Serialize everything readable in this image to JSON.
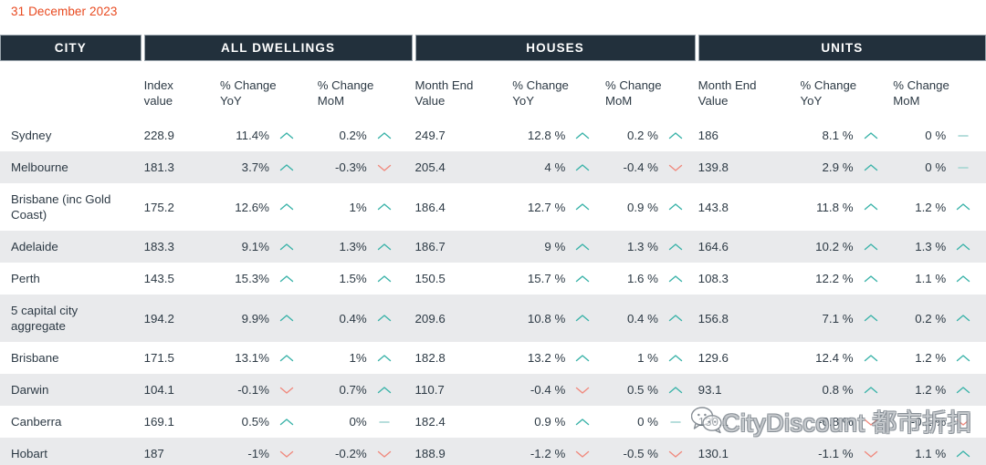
{
  "caption": {
    "date": "31 December 2023",
    "color": "#e8491f"
  },
  "theme": {
    "header_band": "#22303c",
    "alt_row": "#e9eaec",
    "text": "#2d3a45",
    "up": "#3bb3a9",
    "down": "#f08a7e",
    "flat": "#9fd4d0"
  },
  "groups": [
    {
      "label": "CITY"
    },
    {
      "label": "ALL DWELLINGS"
    },
    {
      "label": "HOUSES"
    },
    {
      "label": "UNITS"
    }
  ],
  "columns": [
    {
      "label": ""
    },
    {
      "label": "Index\nvalue"
    },
    {
      "label": "% Change\nYoY"
    },
    {
      "label": "% Change\nMoM"
    },
    {
      "label": "Month End\nValue"
    },
    {
      "label": "% Change\nYoY"
    },
    {
      "label": "% Change\nMoM"
    },
    {
      "label": "Month End\nValue"
    },
    {
      "label": "% Change\nYoY"
    },
    {
      "label": "% Change\nMoM"
    }
  ],
  "rows": [
    {
      "city": "Sydney",
      "dw_index": "228.9",
      "dw_yoy": "11.4%",
      "dw_yoy_dir": "up",
      "dw_mom": "0.2%",
      "dw_mom_dir": "up",
      "h_value": "249.7",
      "h_yoy": "12.8 %",
      "h_yoy_dir": "up",
      "h_mom": "0.2 %",
      "h_mom_dir": "up",
      "u_value": "186",
      "u_yoy": "8.1 %",
      "u_yoy_dir": "up",
      "u_mom": "0 %",
      "u_mom_dir": "flat"
    },
    {
      "city": "Melbourne",
      "dw_index": "181.3",
      "dw_yoy": "3.7%",
      "dw_yoy_dir": "up",
      "dw_mom": "-0.3%",
      "dw_mom_dir": "down",
      "h_value": "205.4",
      "h_yoy": "4 %",
      "h_yoy_dir": "up",
      "h_mom": "-0.4 %",
      "h_mom_dir": "down",
      "u_value": "139.8",
      "u_yoy": "2.9 %",
      "u_yoy_dir": "up",
      "u_mom": "0 %",
      "u_mom_dir": "flat"
    },
    {
      "city": "Brisbane (inc Gold Coast)",
      "dw_index": "175.2",
      "dw_yoy": "12.6%",
      "dw_yoy_dir": "up",
      "dw_mom": "1%",
      "dw_mom_dir": "up",
      "h_value": "186.4",
      "h_yoy": "12.7 %",
      "h_yoy_dir": "up",
      "h_mom": "0.9 %",
      "h_mom_dir": "up",
      "u_value": "143.8",
      "u_yoy": "11.8 %",
      "u_yoy_dir": "up",
      "u_mom": "1.2 %",
      "u_mom_dir": "up"
    },
    {
      "city": "Adelaide",
      "dw_index": "183.3",
      "dw_yoy": "9.1%",
      "dw_yoy_dir": "up",
      "dw_mom": "1.3%",
      "dw_mom_dir": "up",
      "h_value": "186.7",
      "h_yoy": "9 %",
      "h_yoy_dir": "up",
      "h_mom": "1.3 %",
      "h_mom_dir": "up",
      "u_value": "164.6",
      "u_yoy": "10.2 %",
      "u_yoy_dir": "up",
      "u_mom": "1.3 %",
      "u_mom_dir": "up"
    },
    {
      "city": "Perth",
      "dw_index": "143.5",
      "dw_yoy": "15.3%",
      "dw_yoy_dir": "up",
      "dw_mom": "1.5%",
      "dw_mom_dir": "up",
      "h_value": "150.5",
      "h_yoy": "15.7 %",
      "h_yoy_dir": "up",
      "h_mom": "1.6 %",
      "h_mom_dir": "up",
      "u_value": "108.3",
      "u_yoy": "12.2 %",
      "u_yoy_dir": "up",
      "u_mom": "1.1 %",
      "u_mom_dir": "up"
    },
    {
      "city": "5 capital city aggregate",
      "dw_index": "194.2",
      "dw_yoy": "9.9%",
      "dw_yoy_dir": "up",
      "dw_mom": "0.4%",
      "dw_mom_dir": "up",
      "h_value": "209.6",
      "h_yoy": "10.8 %",
      "h_yoy_dir": "up",
      "h_mom": "0.4 %",
      "h_mom_dir": "up",
      "u_value": "156.8",
      "u_yoy": "7.1 %",
      "u_yoy_dir": "up",
      "u_mom": "0.2 %",
      "u_mom_dir": "up"
    },
    {
      "city": "Brisbane",
      "dw_index": "171.5",
      "dw_yoy": "13.1%",
      "dw_yoy_dir": "up",
      "dw_mom": "1%",
      "dw_mom_dir": "up",
      "h_value": "182.8",
      "h_yoy": "13.2 %",
      "h_yoy_dir": "up",
      "h_mom": "1 %",
      "h_mom_dir": "up",
      "u_value": "129.6",
      "u_yoy": "12.4 %",
      "u_yoy_dir": "up",
      "u_mom": "1.2 %",
      "u_mom_dir": "up"
    },
    {
      "city": "Darwin",
      "dw_index": "104.1",
      "dw_yoy": "-0.1%",
      "dw_yoy_dir": "down",
      "dw_mom": "0.7%",
      "dw_mom_dir": "up",
      "h_value": "110.7",
      "h_yoy": "-0.4 %",
      "h_yoy_dir": "down",
      "h_mom": "0.5 %",
      "h_mom_dir": "up",
      "u_value": "93.1",
      "u_yoy": "0.8 %",
      "u_yoy_dir": "up",
      "u_mom": "1.2 %",
      "u_mom_dir": "up"
    },
    {
      "city": "Canberra",
      "dw_index": "169.1",
      "dw_yoy": "0.5%",
      "dw_yoy_dir": "up",
      "dw_mom": "0%",
      "dw_mom_dir": "flat",
      "h_value": "182.4",
      "h_yoy": "0.9 %",
      "h_yoy_dir": "up",
      "h_mom": "0 %",
      "h_mom_dir": "flat",
      "u_value": "130.1",
      "u_yoy": "-0.8 %",
      "u_yoy_dir": "down",
      "u_mom": "-0.1 %",
      "u_mom_dir": "down"
    },
    {
      "city": "Hobart",
      "dw_index": "187",
      "dw_yoy": "-1%",
      "dw_yoy_dir": "down",
      "dw_mom": "-0.2%",
      "dw_mom_dir": "down",
      "h_value": "188.9",
      "h_yoy": "-1.2 %",
      "h_yoy_dir": "down",
      "h_mom": "-0.5 %",
      "h_mom_dir": "down",
      "u_value": "130.1",
      "u_yoy": "-1.1 %",
      "u_yoy_dir": "down",
      "u_mom": "1.1 %",
      "u_mom_dir": "up"
    }
  ],
  "watermark": {
    "text": "CityDiscount 都市折扣",
    "icon": "wechat-bubble-icon"
  }
}
